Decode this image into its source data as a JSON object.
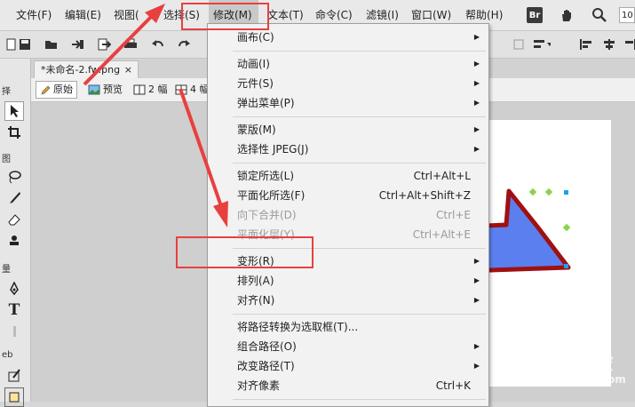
{
  "menubar": {
    "items": [
      {
        "label": "文件(F)"
      },
      {
        "label": "编辑(E)"
      },
      {
        "label": "视图("
      },
      {
        "label": "选择(S)"
      },
      {
        "label": "修改(M)"
      },
      {
        "label": "文本(T)"
      },
      {
        "label": "命令(C)"
      },
      {
        "label": "滤镜(I)"
      },
      {
        "label": "窗口(W)"
      },
      {
        "label": "帮助(H)"
      }
    ],
    "bridge_label": "Br",
    "zoom_value": "10"
  },
  "tools": {
    "section1": "择",
    "section2": "图",
    "section3": "量",
    "section4": "eb"
  },
  "document": {
    "tab_label": "*未命名-2.fw.png",
    "tab_close": "×"
  },
  "viewbar": {
    "original": "原始",
    "preview": "预览",
    "two_up": "2 幅",
    "four_up": "4 幅"
  },
  "modify_menu": {
    "items": [
      {
        "label": "画布(C)",
        "shortcut": "",
        "submenu": true,
        "disabled": false
      },
      {
        "label": "动画(I)",
        "shortcut": "",
        "submenu": true,
        "disabled": false
      },
      {
        "label": "元件(S)",
        "shortcut": "",
        "submenu": true,
        "disabled": false
      },
      {
        "label": "弹出菜单(P)",
        "shortcut": "",
        "submenu": true,
        "disabled": false
      },
      {
        "label": "蒙版(M)",
        "shortcut": "",
        "submenu": true,
        "disabled": false
      },
      {
        "label": "选择性 JPEG(J)",
        "shortcut": "",
        "submenu": true,
        "disabled": false
      },
      {
        "label": "锁定所选(L)",
        "shortcut": "Ctrl+Alt+L",
        "submenu": false,
        "disabled": false
      },
      {
        "label": "平面化所选(F)",
        "shortcut": "Ctrl+Alt+Shift+Z",
        "submenu": false,
        "disabled": false
      },
      {
        "label": "向下合并(D)",
        "shortcut": "Ctrl+E",
        "submenu": false,
        "disabled": true
      },
      {
        "label": "平面化层(Y)",
        "shortcut": "Ctrl+Alt+E",
        "submenu": false,
        "disabled": true
      },
      {
        "label": "变形(R)",
        "shortcut": "",
        "submenu": true,
        "disabled": false
      },
      {
        "label": "排列(A)",
        "shortcut": "",
        "submenu": true,
        "disabled": false
      },
      {
        "label": "对齐(N)",
        "shortcut": "",
        "submenu": true,
        "disabled": false
      },
      {
        "label": "将路径转换为选取框(T)...",
        "shortcut": "",
        "submenu": false,
        "disabled": false
      },
      {
        "label": "组合路径(O)",
        "shortcut": "",
        "submenu": true,
        "disabled": false
      },
      {
        "label": "改变路径(T)",
        "shortcut": "",
        "submenu": true,
        "disabled": false
      },
      {
        "label": "对齐像素",
        "shortcut": "Ctrl+K",
        "submenu": false,
        "disabled": false
      }
    ]
  },
  "watermark": {
    "text": "Baidu经验",
    "url": "jingyan.baidu.com"
  },
  "colors": {
    "annotation_red": "#e8403f",
    "arrow_fill": "#5b7fef",
    "arrow_stroke": "#a01010"
  }
}
